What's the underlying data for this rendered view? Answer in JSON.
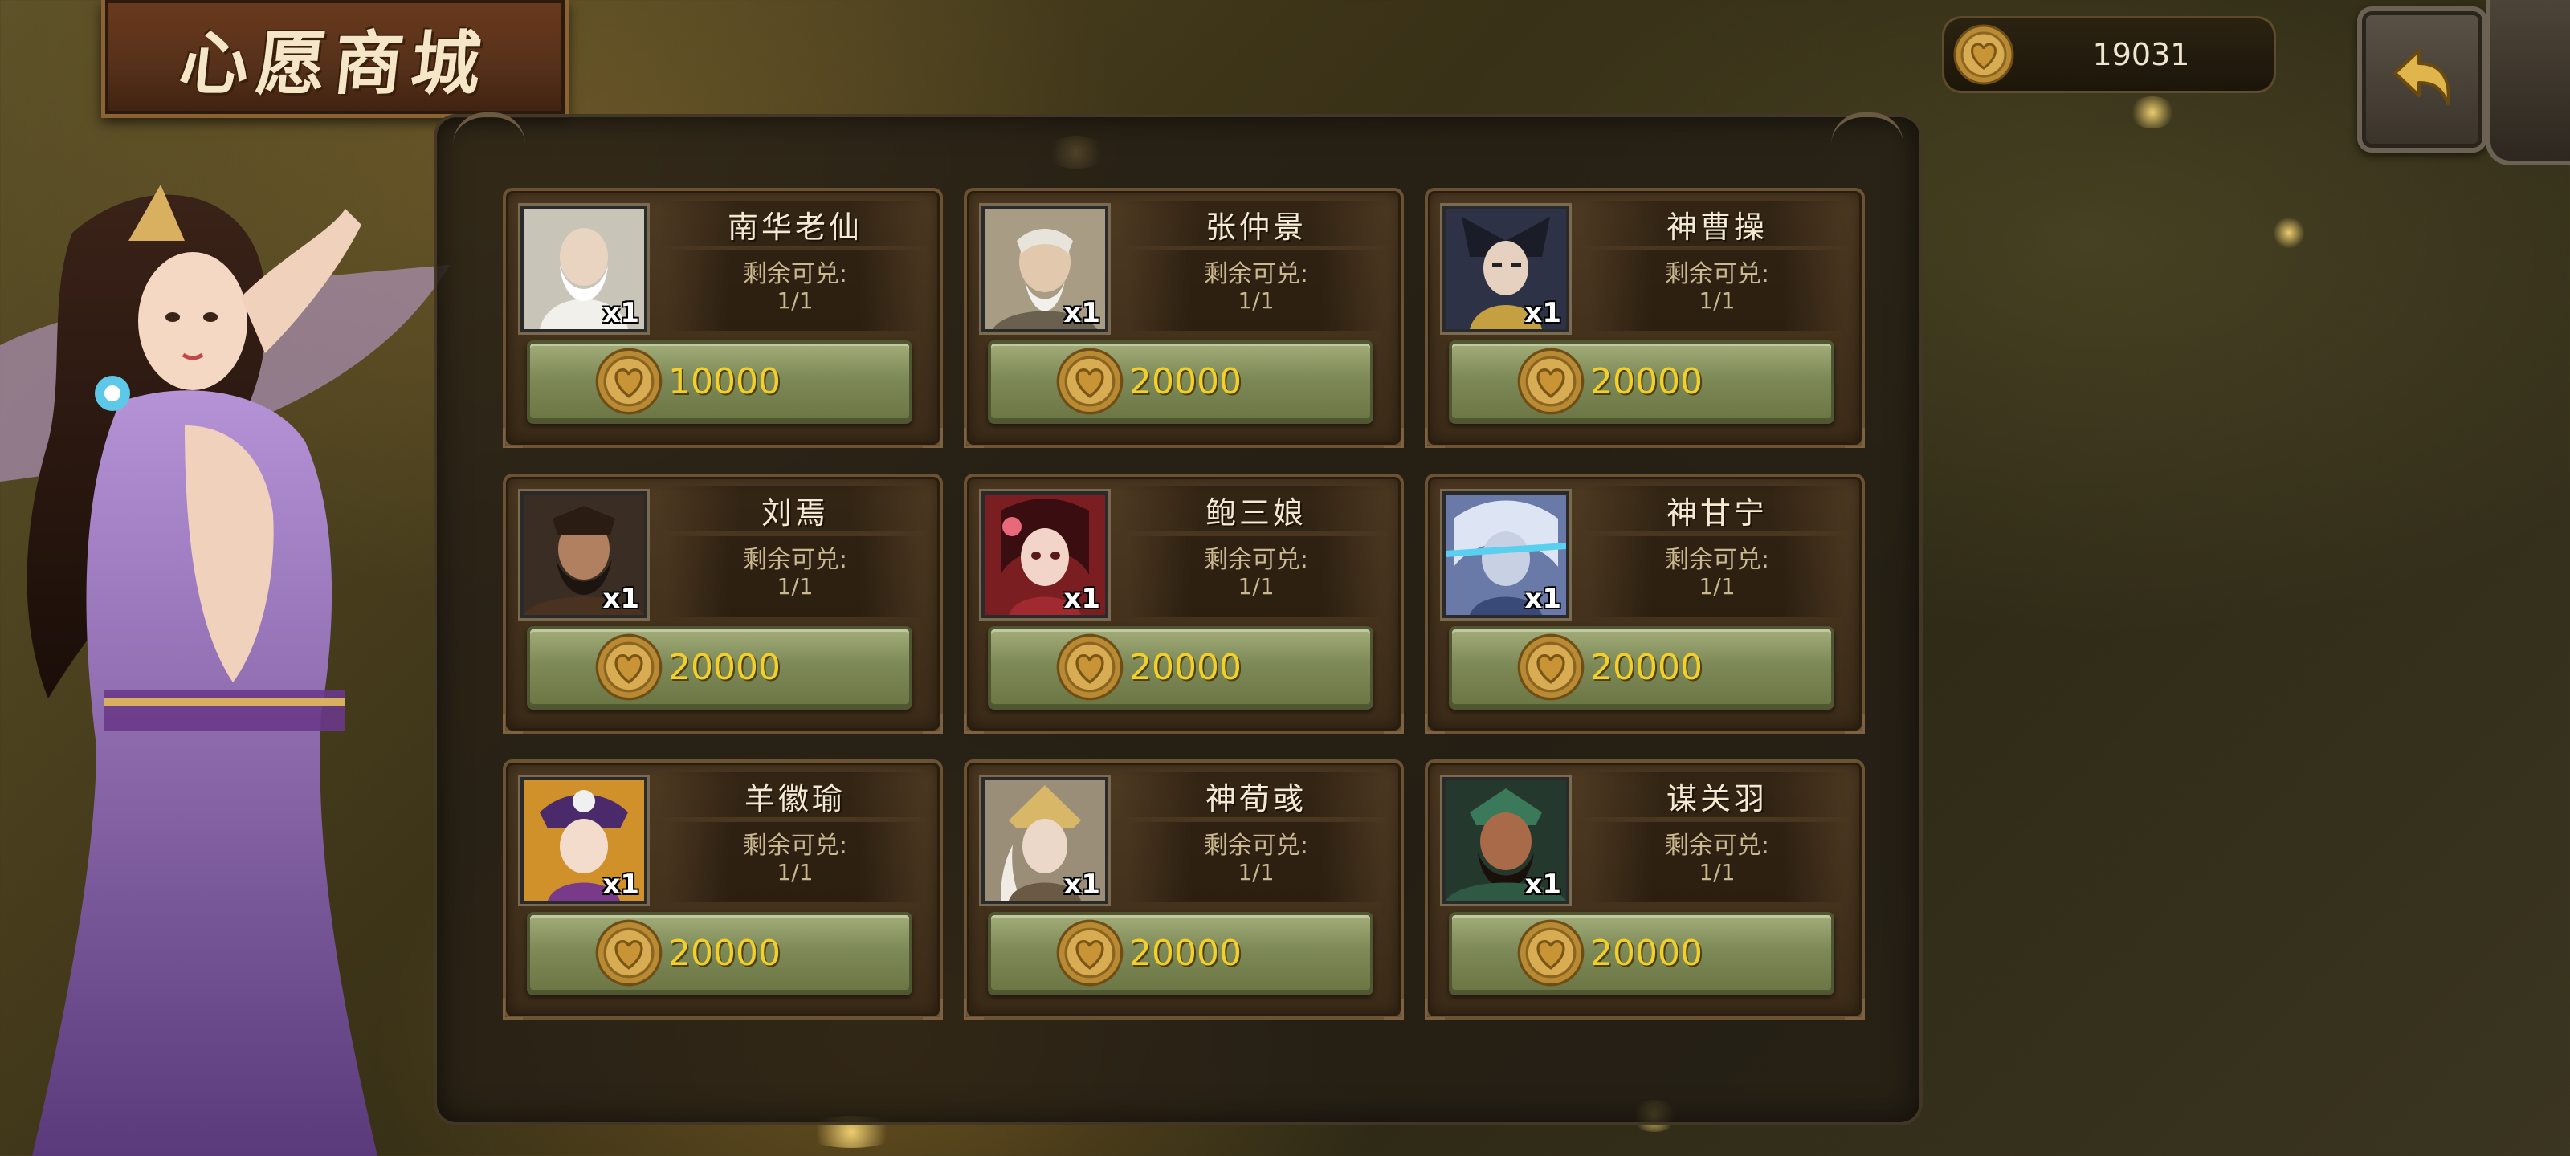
{
  "header": {
    "title": "心愿商城"
  },
  "currency": {
    "icon": "heart-coin-icon",
    "amount": "19031"
  },
  "nav": {
    "back_icon": "back-arrow-icon"
  },
  "shop": {
    "remain_label": "剩余可兑:",
    "items": [
      {
        "name": "南华老仙",
        "qty": "x1",
        "remain": "1/1",
        "price": "10000",
        "portrait_color": "#d8d2c4"
      },
      {
        "name": "张仲景",
        "qty": "x1",
        "remain": "1/1",
        "price": "20000",
        "portrait_color": "#cfc7b2"
      },
      {
        "name": "神曹操",
        "qty": "x1",
        "remain": "1/1",
        "price": "20000",
        "portrait_color": "#3a3f52"
      },
      {
        "name": "刘焉",
        "qty": "x1",
        "remain": "1/1",
        "price": "20000",
        "portrait_color": "#4a3a2a"
      },
      {
        "name": "鲍三娘",
        "qty": "x1",
        "remain": "1/1",
        "price": "20000",
        "portrait_color": "#8a2a2a"
      },
      {
        "name": "神甘宁",
        "qty": "x1",
        "remain": "1/1",
        "price": "20000",
        "portrait_color": "#9aa6c8"
      },
      {
        "name": "羊徽瑜",
        "qty": "x1",
        "remain": "1/1",
        "price": "20000",
        "portrait_color": "#c8902e"
      },
      {
        "name": "神荀彧",
        "qty": "x1",
        "remain": "1/1",
        "price": "20000",
        "portrait_color": "#b4a88c"
      },
      {
        "name": "谋关羽",
        "qty": "x1",
        "remain": "1/1",
        "price": "20000",
        "portrait_color": "#2e4a3a"
      }
    ]
  },
  "colors": {
    "price_text": "#f2cf2a",
    "button_green": "#7d8956",
    "card_brown": "#4e3a22"
  }
}
